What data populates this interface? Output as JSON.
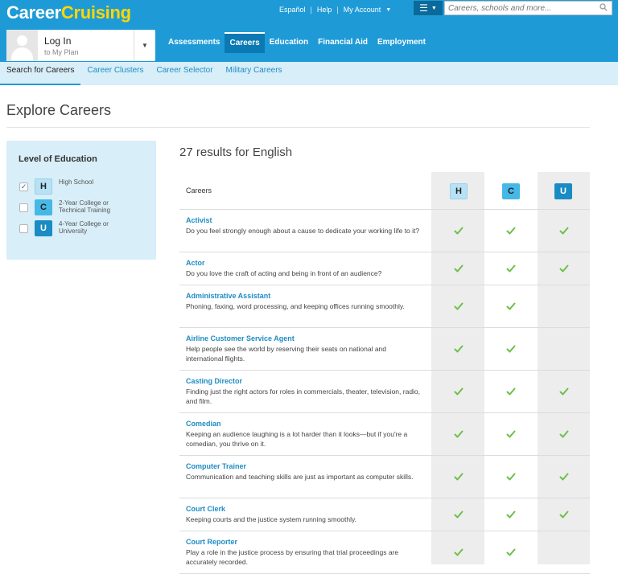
{
  "brand": {
    "part1": "Career",
    "part2": "Cruising"
  },
  "toplinks": {
    "espanol": "Español",
    "help": "Help",
    "account": "My Account"
  },
  "search": {
    "placeholder": "Careers, schools and more..."
  },
  "login": {
    "title": "Log In",
    "subtitle": "to My Plan"
  },
  "nav": [
    "Assessments",
    "Careers",
    "Education",
    "Financial Aid",
    "Employment"
  ],
  "nav_active": "Careers",
  "subnav": [
    "Search for Careers",
    "Career Clusters",
    "Career Selector",
    "Military Careers"
  ],
  "subnav_active": "Search for Careers",
  "page_title": "Explore Careers",
  "filter": {
    "heading": "Level of Education",
    "options": [
      {
        "badge": "H",
        "label": "High School",
        "checked": true
      },
      {
        "badge": "C",
        "label": "2-Year College or Technical Training",
        "checked": false
      },
      {
        "badge": "U",
        "label": "4-Year College or University",
        "checked": false
      }
    ]
  },
  "results_text": "27 results for English",
  "table": {
    "col_label": "Careers",
    "badges": [
      "H",
      "C",
      "U"
    ],
    "rows": [
      {
        "name": "Activist",
        "desc": "Do you feel strongly enough about a cause to dedicate your working life to it?",
        "h": true,
        "c": true,
        "u": true
      },
      {
        "name": "Actor",
        "desc": "Do you love the craft of acting and being in front of an audience?",
        "h": true,
        "c": true,
        "u": true
      },
      {
        "name": "Administrative Assistant",
        "desc": "Phoning, faxing, word processing, and keeping offices running smoothly.",
        "h": true,
        "c": true,
        "u": false
      },
      {
        "name": "Airline Customer Service Agent",
        "desc": "Help people see the world by reserving their seats on national and international flights.",
        "h": true,
        "c": true,
        "u": false
      },
      {
        "name": "Casting Director",
        "desc": "Finding just the right actors for roles in commercials, theater, television, radio, and film.",
        "h": true,
        "c": true,
        "u": true
      },
      {
        "name": "Comedian",
        "desc": "Keeping an audience laughing is a lot harder than it looks—but if you're a comedian, you thrive on it.",
        "h": true,
        "c": true,
        "u": true
      },
      {
        "name": "Computer Trainer",
        "desc": "Communication and teaching skills are just as important as computer skills.",
        "h": true,
        "c": true,
        "u": true
      },
      {
        "name": "Court Clerk",
        "desc": "Keeping courts and the justice system running smoothly.",
        "h": true,
        "c": true,
        "u": true
      },
      {
        "name": "Court Reporter",
        "desc": "Play a role in the justice process by ensuring that trial proceedings are accurately recorded.",
        "h": true,
        "c": true,
        "u": false
      }
    ]
  },
  "colors": {
    "header": "#1e9bd7",
    "subnav": "#d8eef8",
    "link": "#1e8cc4",
    "check": "#6cc04a"
  }
}
